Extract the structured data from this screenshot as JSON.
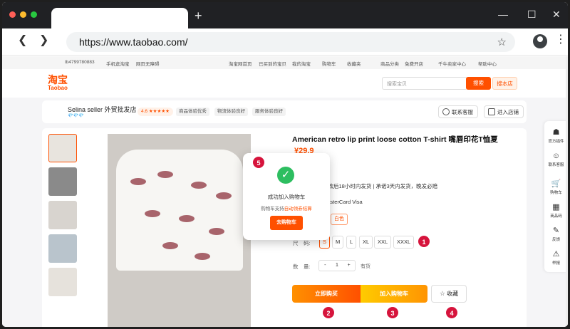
{
  "browser": {
    "url": "https://www.taobao.com/",
    "new_tab_glyph": "+",
    "back_glyph": "❮",
    "forward_glyph": "❯",
    "star_glyph": "☆",
    "kebab_glyph": "⋮",
    "minimize_glyph": "—",
    "maximize_glyph": "☐",
    "close_glyph": "✕",
    "traffic_colors": [
      "#ff5f57",
      "#febc2e",
      "#28c840"
    ]
  },
  "sitenav": {
    "user": "tb4799780883",
    "mobile": "手机逛淘宝",
    "accessibility": "网页无障碍",
    "home": "淘宝网首页",
    "bought": "已买到的宝贝",
    "mytaobao": "我的淘宝",
    "cart": "购物车",
    "favorites": "收藏夹",
    "category": "商品分类",
    "free_shop": "免费开店",
    "seller_center": "千牛卖家中心",
    "help": "帮助中心"
  },
  "header": {
    "logo_cn": "淘宝",
    "logo_en": "Taobao",
    "search_placeholder": "搜索宝贝",
    "search_btn": "搜索",
    "search_shop_btn": "搜本店"
  },
  "shop": {
    "name": "Selina seller 外贸批发店",
    "diamonds": "💎💎💎",
    "rating": "4.6 ★★★★★",
    "tag1": "商品体验优秀",
    "tag2": "物流体验良好",
    "tag3": "服务体验良好",
    "contact": "联系客服",
    "enter": "进入店铺"
  },
  "product": {
    "title": "American retro lip print loose cotton T-shirt 嘴唇印花T恤夏",
    "price": "¥29.9",
    "shipping": "付款后18小时内发货 | 承诺3天内发货，晚发必赔",
    "payment": "MasterCard  Visa",
    "color": "白色",
    "size_label": "尺　码:",
    "sizes": [
      "S",
      "M",
      "L",
      "XL",
      "XXL",
      "XXXL"
    ],
    "qty_label": "数　量:",
    "qty_minus": "-",
    "qty_value": "1",
    "qty_plus": "+",
    "stock": "有货",
    "buy_now": "立即购买",
    "add_cart": "加入购物车",
    "favorite": "收藏",
    "favorite_glyph": "☆"
  },
  "popup": {
    "check_glyph": "✓",
    "title": "成功加入购物车",
    "sub_prefix": "购物车支持",
    "sub_highlight": "自动领券结算",
    "button": "去购物车"
  },
  "badges": [
    "1",
    "2",
    "3",
    "4",
    "5"
  ],
  "sidetools": [
    {
      "glyph": "☗",
      "label": "官方插件"
    },
    {
      "glyph": "☺",
      "label": "联系客服"
    },
    {
      "glyph": "🛒",
      "label": "购物车"
    },
    {
      "glyph": "▦",
      "label": "商品码"
    },
    {
      "glyph": "✎",
      "label": "反馈"
    },
    {
      "glyph": "⚠",
      "label": "举报"
    }
  ],
  "colors": {
    "accent": "#ff5000",
    "badge": "#d6143c",
    "success": "#2dbe60"
  }
}
